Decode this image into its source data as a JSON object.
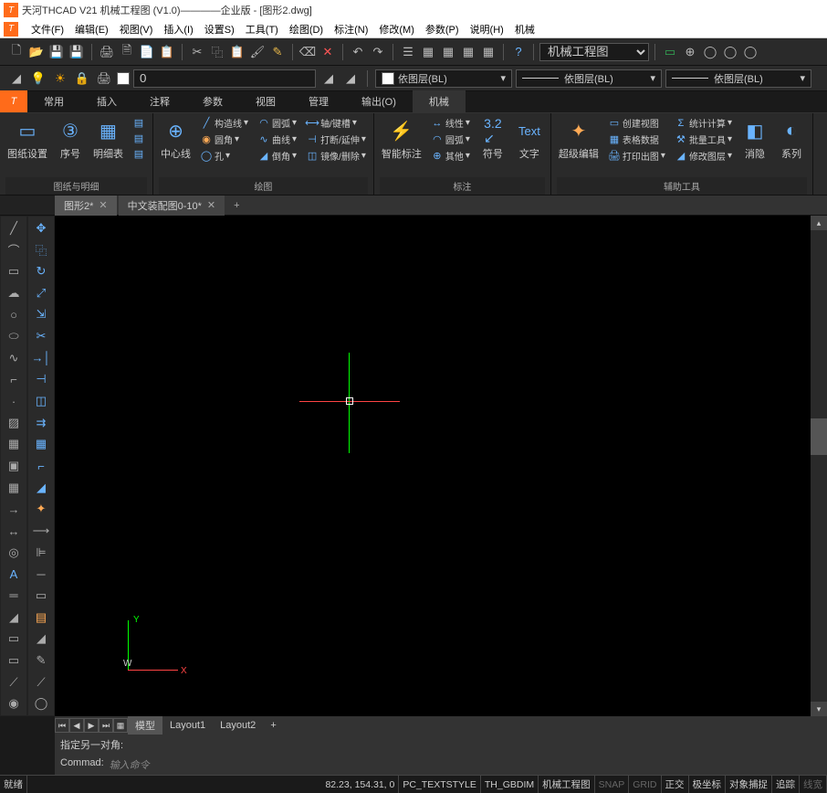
{
  "title": "天河THCAD V21 机械工程图 (V1.0)————企业版 - [图形2.dwg]",
  "menus": [
    "文件(F)",
    "编辑(E)",
    "视图(V)",
    "插入(I)",
    "设置S)",
    "工具(T)",
    "绘图(D)",
    "标注(N)",
    "修改(M)",
    "参数(P)",
    "说明(H)",
    "机械"
  ],
  "toolbar_dropdown": "机械工程图",
  "layer": {
    "current": "0",
    "by1": "依图层(BL)",
    "by2": "依图层(BL)",
    "by3": "依图层(BL)"
  },
  "ribbon_tabs": [
    "常用",
    "插入",
    "注释",
    "参数",
    "视图",
    "管理",
    "输出(O)",
    "机械"
  ],
  "ribbon_active": 7,
  "ribbon_panels": {
    "p1": {
      "title": "图纸与明细",
      "items": [
        "图纸设置",
        "序号",
        "明细表"
      ]
    },
    "p2": {
      "title": "绘图",
      "big": "中心线",
      "rows": [
        [
          "构造线",
          "圆弧",
          "轴/键槽"
        ],
        [
          "圆角",
          "曲线",
          "打断/延伸"
        ],
        [
          "孔",
          "倒角",
          "镜像/删除"
        ]
      ]
    },
    "p3": {
      "title": "标注",
      "big": "智能标注",
      "rows": [
        [
          "线性"
        ],
        [
          "圆弧"
        ],
        [
          "其他"
        ]
      ],
      "big2": "符号",
      "big3": "Text",
      "big3label": "文字"
    },
    "p4": {
      "title": "辅助工具",
      "big": "超级编辑",
      "rows": [
        [
          "创建视图",
          "统计计算"
        ],
        [
          "表格数据",
          "批量工具"
        ],
        [
          "打印出图",
          "修改图层"
        ]
      ],
      "big2": "消隐",
      "big3": "系列"
    }
  },
  "doc_tabs": [
    {
      "name": "图形2*",
      "active": true
    },
    {
      "name": "中文装配图0-10*",
      "active": false
    }
  ],
  "ucs": {
    "x": "X",
    "y": "Y",
    "w": "W"
  },
  "bottom_tabs": {
    "model": "模型",
    "l1": "Layout1",
    "l2": "Layout2"
  },
  "cmd_history": "指定另一对角:",
  "cmd_prompt": "Commad:",
  "cmd_hint": "输入命令",
  "status": {
    "ready": "就绪",
    "coords": "82.23, 154.31, 0",
    "textstyle": "PC_TEXTSTYLE",
    "dimstyle": "TH_GBDIM",
    "wks": "机械工程图",
    "snap": "SNAP",
    "grid": "GRID",
    "ortho": "正交",
    "polar": "极坐标",
    "osnap": "对象捕捉",
    "track": "追踪",
    "lw": "线宽"
  }
}
